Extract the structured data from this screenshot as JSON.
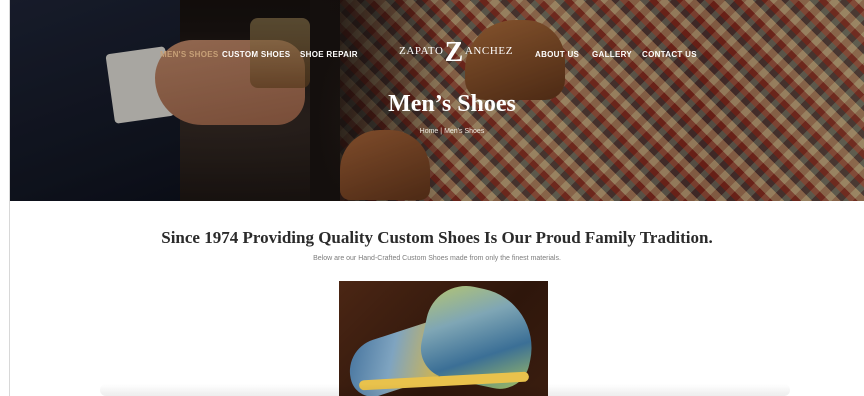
{
  "nav": {
    "left": [
      {
        "label": "MEN'S SHOES",
        "active": true
      },
      {
        "label": "CUSTOM SHOES",
        "active": false
      },
      {
        "label": "SHOE REPAIR",
        "active": false
      }
    ],
    "right": [
      {
        "label": "ABOUT US"
      },
      {
        "label": "GALLERY"
      },
      {
        "label": "CONTACT US"
      }
    ]
  },
  "logo": {
    "left": "ZAPATO",
    "mark": "Z",
    "right": "ANCHEZ"
  },
  "hero": {
    "title": "Men’s Shoes",
    "breadcrumb": {
      "home": "Home",
      "separator": "|",
      "current": "Men's Shoes"
    }
  },
  "content": {
    "headline": "Since 1974 Providing Quality Custom Shoes Is Our Proud Family Tradition.",
    "subline": "Below are our Hand-Crafted Custom Shoes made from only the finest materials."
  },
  "colors": {
    "accent": "#c7a077",
    "text": "#2b2b2b"
  }
}
